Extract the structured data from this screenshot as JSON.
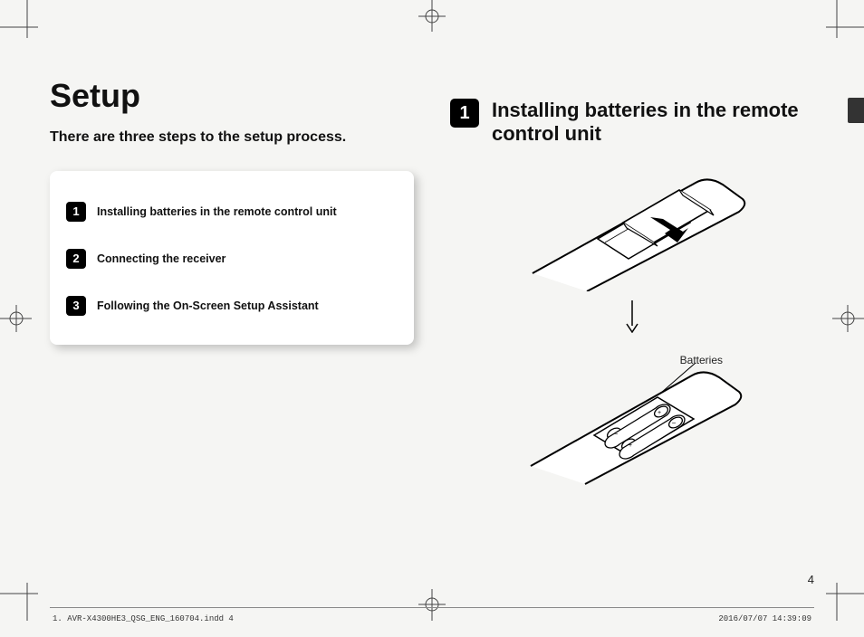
{
  "header": {
    "title": "Setup",
    "subtitle": "There are three steps to the setup process."
  },
  "steps": {
    "1": {
      "num": "1",
      "label": "Installing batteries in the remote control unit"
    },
    "2": {
      "num": "2",
      "label": "Connecting the receiver"
    },
    "3": {
      "num": "3",
      "label": "Following the On-Screen Setup Assistant"
    }
  },
  "section": {
    "num": "1",
    "title": "Installing batteries in the remote control unit"
  },
  "illustration": {
    "batt_label": "Batteries"
  },
  "footer": {
    "file": "1. AVR-X4300HE3_QSG_ENG_160704.indd   4",
    "timestamp": "2016/07/07   14:39:09",
    "page_number": "4"
  }
}
